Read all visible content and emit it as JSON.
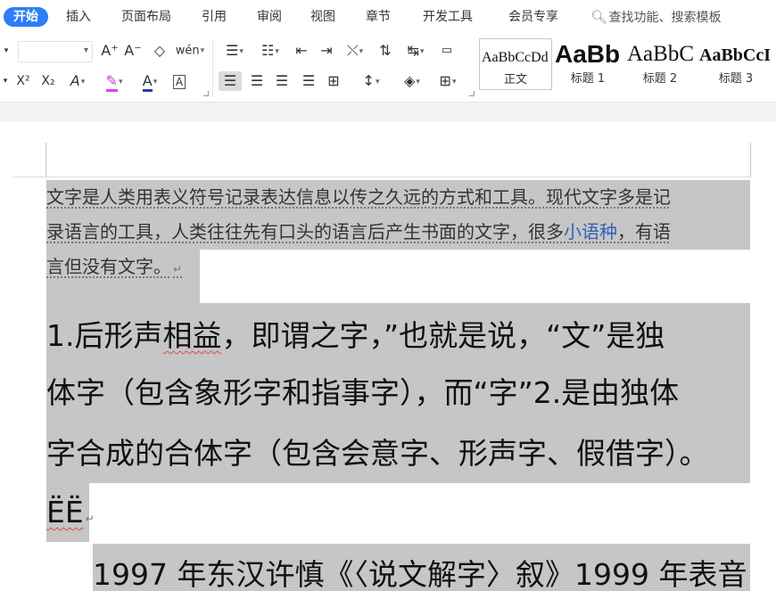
{
  "menu": {
    "tabs": [
      "开始",
      "插入",
      "页面布局",
      "引用",
      "审阅",
      "视图",
      "章节",
      "开发工具",
      "会员专享"
    ],
    "search": "查找功能、搜索模板"
  },
  "ribbon": {
    "font_size_value": "",
    "row1_buttons": [
      "A⁺",
      "A⁻",
      "◇",
      "wén",
      "☰",
      "☰",
      "⇤",
      "⇥",
      "⇆",
      "⊿",
      "↹",
      "▭"
    ],
    "row2_buttons": [
      "X²",
      "X₂",
      "A",
      "✎",
      "A",
      "A"
    ],
    "styles": [
      {
        "sample": "AaBbCcDd",
        "label": "正文"
      },
      {
        "sample": "AaBb",
        "label": "标题 1"
      },
      {
        "sample": "AaBbC",
        "label": "标题 2"
      },
      {
        "sample": "AaBbCcI",
        "label": "标题 3"
      }
    ]
  },
  "document": {
    "para1": {
      "line1": "文字是人类用表义符号记录表达信息以传之久远的方式和工具。现代文字多是记",
      "line2_a": "录语言的工具，人类往往先有口头的语言后产生书面的文字，很多",
      "line2_link": "小语种",
      "line2_b": "，有语",
      "line3": "言但没有文字。"
    },
    "para2": {
      "line1_a": "1.后形声",
      "line1_err": "相益",
      "line1_b": "，即谓之字，”也就是说，“文”是独",
      "line2": "体字（包含象形字和指事字），而“字”2.是由独体",
      "line3": "字合成的合体字（包含会意字、形声字、假借字）。",
      "line4": "ËË"
    },
    "para3": {
      "line1": "1997 年东汉许慎《〈说文解字〉叙》1999 年表音"
    },
    "paragraph_mark": "↵"
  }
}
